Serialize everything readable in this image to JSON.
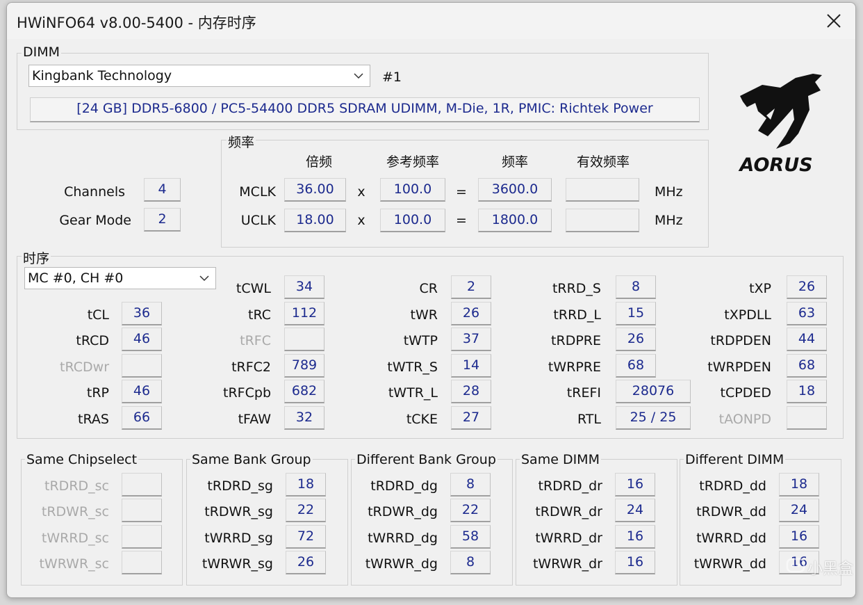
{
  "window": {
    "title": "HWiNFO64 v8.00-5400 - 内存时序"
  },
  "dimm": {
    "group_label": "DIMM",
    "selected_module": "Kingbank Technology",
    "slot": "#1",
    "description": "[24 GB] DDR5-6800 / PC5-54400 DDR5 SDRAM UDIMM, M-Die, 1R, PMIC: Richtek Power"
  },
  "logo": {
    "brand": "AORUS"
  },
  "general": {
    "channels_label": "Channels",
    "channels": "4",
    "gear_label": "Gear Mode",
    "gear": "2"
  },
  "freq": {
    "group_label": "频率",
    "headers": {
      "mult": "倍频",
      "ref": "参考频率",
      "freq": "频率",
      "eff": "有效频率"
    },
    "x_sign": "x",
    "eq_sign": "=",
    "unit": "MHz",
    "mclk": {
      "label": "MCLK",
      "mult": "36.00",
      "ref": "100.0",
      "freq": "3600.0",
      "eff": ""
    },
    "uclk": {
      "label": "UCLK",
      "mult": "18.00",
      "ref": "100.0",
      "freq": "1800.0",
      "eff": ""
    }
  },
  "timing": {
    "group_label": "时序",
    "selected_channel": "MC #0, CH #0",
    "col1": [
      {
        "label": "tCL",
        "value": "36",
        "disabled": false
      },
      {
        "label": "tRCD",
        "value": "46",
        "disabled": false
      },
      {
        "label": "tRCDwr",
        "value": "",
        "disabled": true
      },
      {
        "label": "tRP",
        "value": "46",
        "disabled": false
      },
      {
        "label": "tRAS",
        "value": "66",
        "disabled": false
      }
    ],
    "col2": [
      {
        "label": "tCWL",
        "value": "34",
        "disabled": false
      },
      {
        "label": "tRC",
        "value": "112",
        "disabled": false
      },
      {
        "label": "tRFC",
        "value": "",
        "disabled": true
      },
      {
        "label": "tRFC2",
        "value": "789",
        "disabled": false
      },
      {
        "label": "tRFCpb",
        "value": "682",
        "disabled": false
      },
      {
        "label": "tFAW",
        "value": "32",
        "disabled": false
      }
    ],
    "col3": [
      {
        "label": "CR",
        "value": "2",
        "disabled": false
      },
      {
        "label": "tWR",
        "value": "26",
        "disabled": false
      },
      {
        "label": "tWTP",
        "value": "37",
        "disabled": false
      },
      {
        "label": "tWTR_S",
        "value": "14",
        "disabled": false
      },
      {
        "label": "tWTR_L",
        "value": "28",
        "disabled": false
      },
      {
        "label": "tCKE",
        "value": "27",
        "disabled": false
      }
    ],
    "col4": [
      {
        "label": "tRRD_S",
        "value": "8",
        "disabled": false
      },
      {
        "label": "tRRD_L",
        "value": "15",
        "disabled": false
      },
      {
        "label": "tRDPRE",
        "value": "26",
        "disabled": false
      },
      {
        "label": "tWRPRE",
        "value": "68",
        "disabled": false
      },
      {
        "label": "tREFI",
        "value": "28076",
        "disabled": false
      },
      {
        "label": "RTL",
        "value": "25 / 25",
        "disabled": false
      }
    ],
    "col5": [
      {
        "label": "tXP",
        "value": "26",
        "disabled": false
      },
      {
        "label": "tXPDLL",
        "value": "63",
        "disabled": false
      },
      {
        "label": "tRDPDEN",
        "value": "44",
        "disabled": false
      },
      {
        "label": "tWRPDEN",
        "value": "68",
        "disabled": false
      },
      {
        "label": "tCPDED",
        "value": "18",
        "disabled": false
      },
      {
        "label": "tAONPD",
        "value": "",
        "disabled": true
      }
    ]
  },
  "turnaround": [
    {
      "title": "Same Chipselect",
      "rows": [
        {
          "label": "tRDRD_sc",
          "value": "",
          "disabled": true
        },
        {
          "label": "tRDWR_sc",
          "value": "",
          "disabled": true
        },
        {
          "label": "tWRRD_sc",
          "value": "",
          "disabled": true
        },
        {
          "label": "tWRWR_sc",
          "value": "",
          "disabled": true
        }
      ]
    },
    {
      "title": "Same Bank Group",
      "rows": [
        {
          "label": "tRDRD_sg",
          "value": "18",
          "disabled": false
        },
        {
          "label": "tRDWR_sg",
          "value": "22",
          "disabled": false
        },
        {
          "label": "tWRRD_sg",
          "value": "72",
          "disabled": false
        },
        {
          "label": "tWRWR_sg",
          "value": "26",
          "disabled": false
        }
      ]
    },
    {
      "title": "Different Bank Group",
      "rows": [
        {
          "label": "tRDRD_dg",
          "value": "8",
          "disabled": false
        },
        {
          "label": "tRDWR_dg",
          "value": "22",
          "disabled": false
        },
        {
          "label": "tWRRD_dg",
          "value": "58",
          "disabled": false
        },
        {
          "label": "tWRWR_dg",
          "value": "8",
          "disabled": false
        }
      ]
    },
    {
      "title": "Same DIMM",
      "rows": [
        {
          "label": "tRDRD_dr",
          "value": "16",
          "disabled": false
        },
        {
          "label": "tRDWR_dr",
          "value": "24",
          "disabled": false
        },
        {
          "label": "tWRRD_dr",
          "value": "16",
          "disabled": false
        },
        {
          "label": "tWRWR_dr",
          "value": "16",
          "disabled": false
        }
      ]
    },
    {
      "title": "Different DIMM",
      "rows": [
        {
          "label": "tRDRD_dd",
          "value": "18",
          "disabled": false
        },
        {
          "label": "tRDWR_dd",
          "value": "24",
          "disabled": false
        },
        {
          "label": "tWRRD_dd",
          "value": "16",
          "disabled": false
        },
        {
          "label": "tWRWR_dd",
          "value": "16",
          "disabled": false
        }
      ]
    }
  ],
  "watermark": {
    "text": "小黑盒"
  }
}
